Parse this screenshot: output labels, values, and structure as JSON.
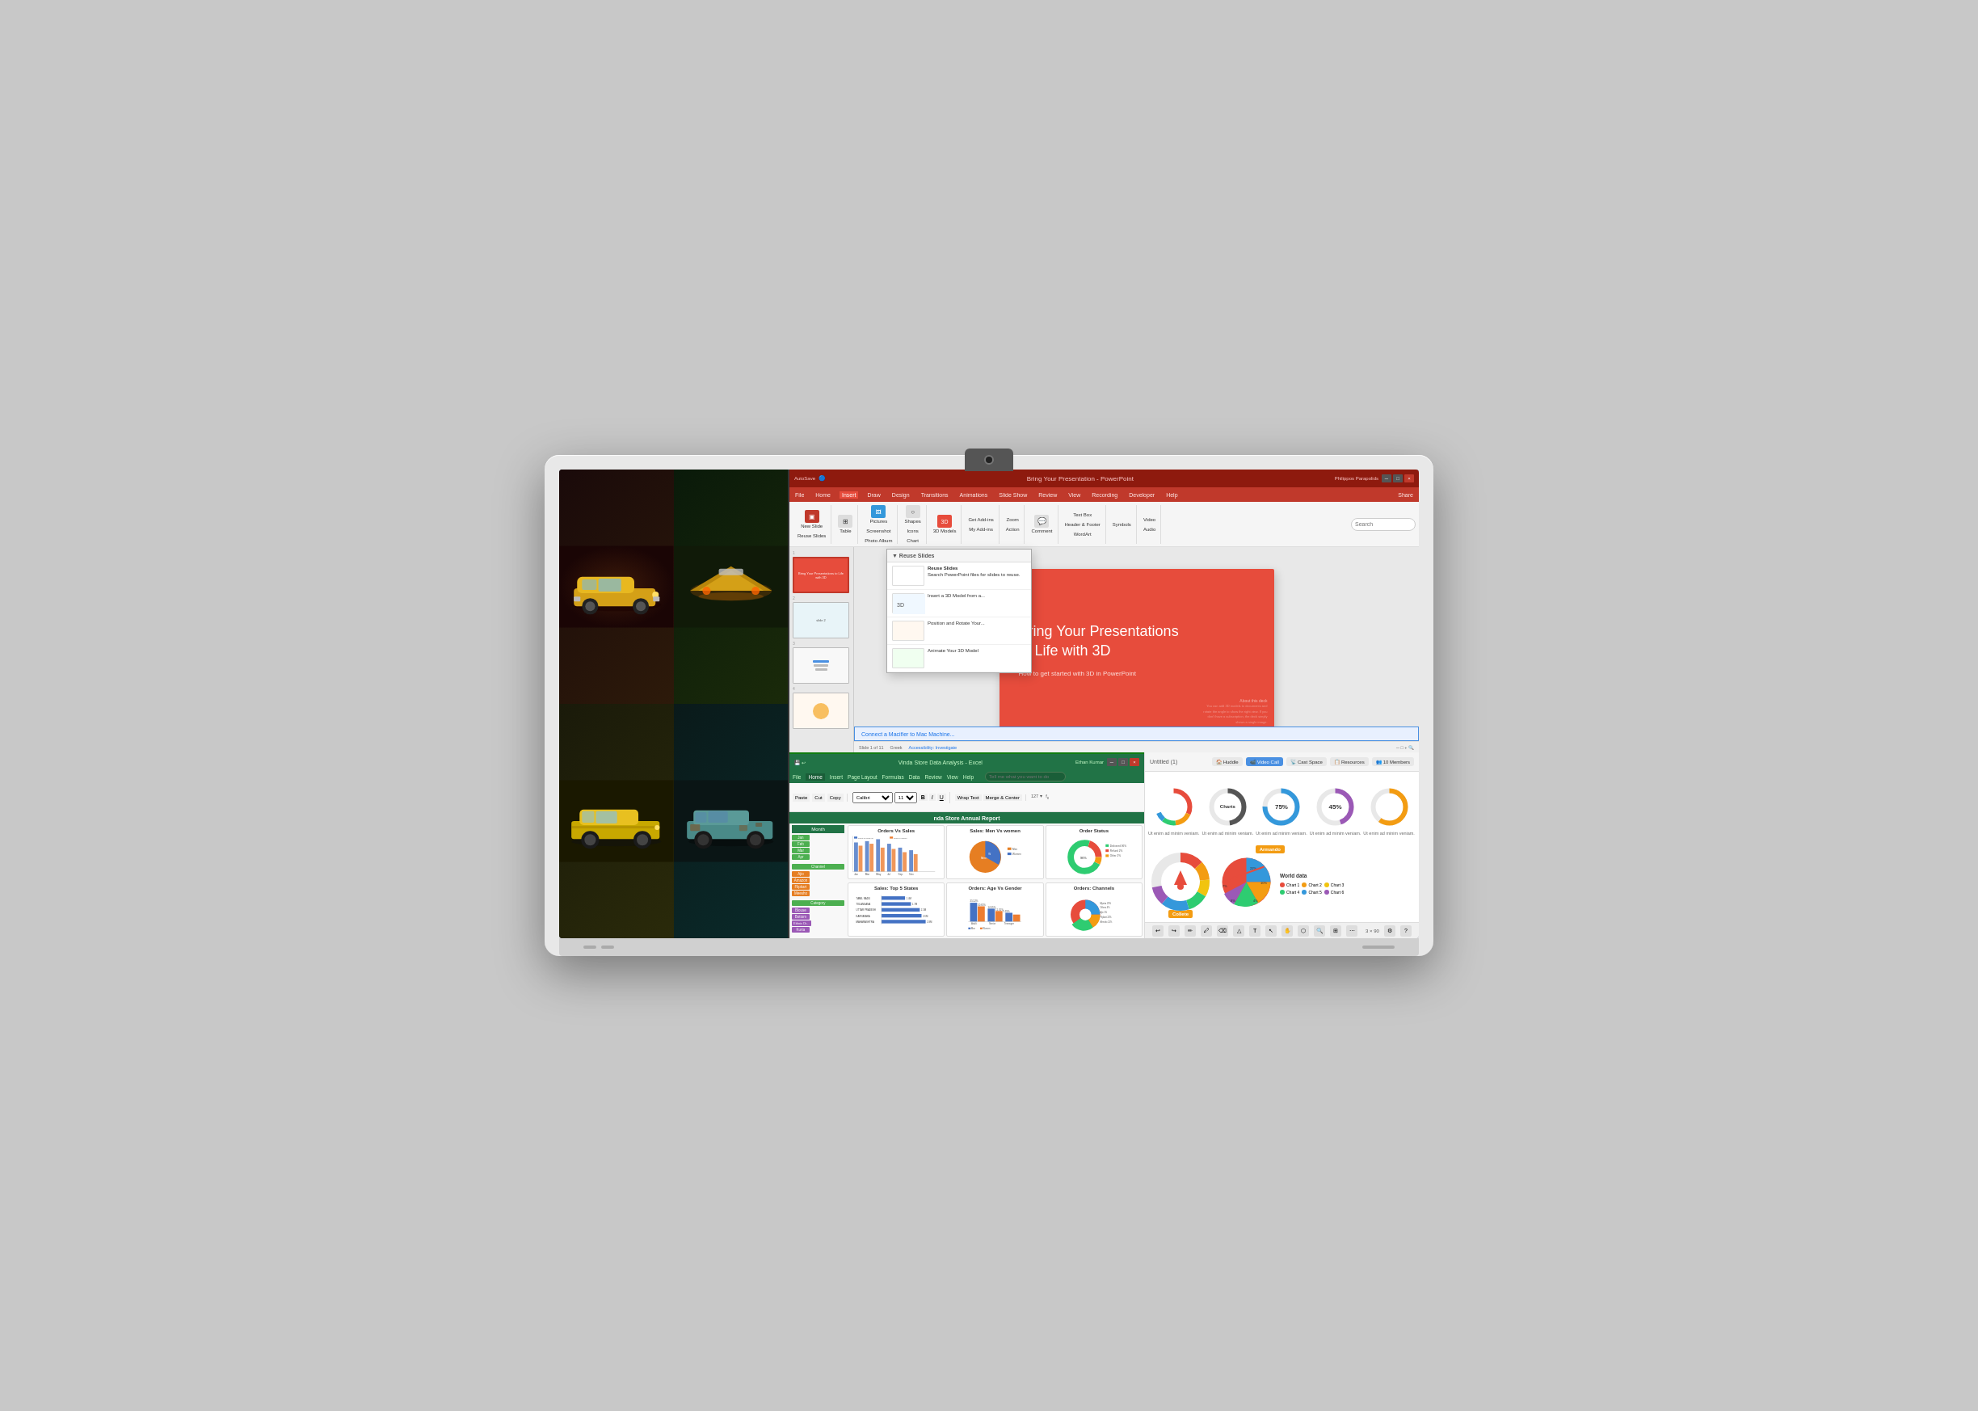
{
  "monitor": {
    "title": "All-in-one display with camera"
  },
  "ppt": {
    "title_bar": "Bring Your Presentation - PowerPoint",
    "auto_save": "AutoSave",
    "file_name": "Bring Your Presentations to Life with 3D",
    "menu_items": [
      "File",
      "Home",
      "Insert",
      "Draw",
      "Design",
      "Transitions",
      "Animations",
      "Slide Show",
      "Review",
      "View",
      "Recording",
      "Developer",
      "Help"
    ],
    "active_tab": "Insert",
    "slide_title_line1": "Bring Your Presentations",
    "slide_title_line2": "to Life with 3D",
    "slide_subtitle": "How to get started with 3D in PowerPoint",
    "slide_note": "About this deck",
    "share_btn": "Share",
    "search_placeholder": "Search",
    "toolbar_items": [
      "New Slide",
      "Reuse Slides",
      "Table",
      "Pictures",
      "Screenshot",
      "Photo Album",
      "Shapes",
      "Icons",
      "Chart",
      "3D Models",
      "Get Add-ins",
      "My Add-ins",
      "Zoom",
      "Action",
      "Comment",
      "Text Box",
      "Header & Footer",
      "WordArt",
      "Symbols",
      "Video",
      "Audio"
    ],
    "dropdown_items": [
      {
        "title": "Reuse Slides",
        "desc": "Search PowerPoint files for slides to reuse."
      },
      {
        "title": "Insert a 3D Model from a...",
        "desc": ""
      },
      {
        "title": "Position and Rotate Your...",
        "desc": ""
      },
      {
        "title": "Animate Your 3D Model",
        "desc": ""
      }
    ]
  },
  "excel": {
    "title": "Vinda Store Data Analysis - Excel",
    "user": "Ethan Kumar",
    "file_name": "nda Store Annual Report",
    "menu_items": [
      "File",
      "Home",
      "Insert",
      "Page Layout",
      "Formulas",
      "Data",
      "Review",
      "View",
      "Help"
    ],
    "active_tab": "Home",
    "charts": [
      {
        "title": "Orders Vs Sales",
        "type": "bar"
      },
      {
        "title": "Sales: Men Vs women",
        "type": "pie"
      },
      {
        "title": "Order Status",
        "type": "donut"
      }
    ],
    "bottom_charts": [
      {
        "title": "Sales: Top 5 States",
        "type": "bar_h"
      },
      {
        "title": "Orders: Age Vs Gender",
        "type": "bar"
      },
      {
        "title": "Orders: Channels",
        "type": "pie"
      }
    ],
    "states": [
      "TAMIL NADU",
      "TELANGANA",
      "UTTAR PRADESH",
      "KARNATAKA",
      "MAHARASHTRA"
    ],
    "state_values": [
      "1.4M",
      "1.7M",
      "2.5M",
      "2.6M",
      "2.8M"
    ],
    "row_labels": [
      "Month",
      "Jan",
      "Feb",
      "Mar",
      "Apr",
      "Channel",
      "Ajio",
      "Amazon",
      "Flipkart",
      "Meesho",
      "Category",
      "Blouse",
      "Bottom",
      "Ethnic Dr...",
      "Kurta"
    ]
  },
  "meeting": {
    "title": "Untitled (1)",
    "buttons": [
      "Huddle",
      "Video Call",
      "Cast Space",
      "Resources",
      "10 Members"
    ],
    "cast_space_label": "Cast Space",
    "charts_label": "Charts",
    "percent_75": "75%",
    "percent_45": "45%",
    "world_data_title": "World data",
    "legend_items": [
      "Chart 1",
      "Chart 2",
      "Chart 3",
      "Chart 4",
      "Chart 5",
      "Chart 6"
    ],
    "legend_colors": [
      "#e74c3c",
      "#f39c12",
      "#f1c40f",
      "#2ecc71",
      "#3498db",
      "#9b59b6"
    ],
    "donut_labels": [
      "Ut enim ad minim veniam.",
      "Ut enim ad minim veniam.",
      "Ut enim ad minim veniam.",
      "Ut enim ad minim veniam.",
      "Ut enim ad minim veniam."
    ],
    "collete_label": "Collete",
    "armando_label": "Armando"
  },
  "footer": {
    "tools": [
      "pencil",
      "eraser",
      "shapes",
      "text",
      "select",
      "zoom",
      "more"
    ]
  }
}
